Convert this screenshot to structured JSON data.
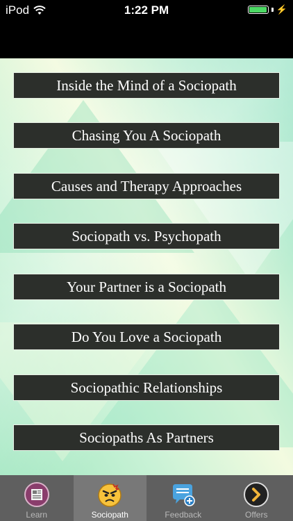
{
  "status_bar": {
    "carrier": "iPod",
    "time": "1:22 PM",
    "battery_level": 1.0,
    "charging": true
  },
  "menu": {
    "items": [
      "Inside the Mind of a Sociopath",
      "Chasing You A Sociopath",
      "Causes and Therapy Approaches",
      "Sociopath vs. Psychopath",
      "Your Partner is a Sociopath",
      "Do You Love a Sociopath",
      "Sociopathic Relationships",
      "Sociopaths As Partners"
    ]
  },
  "tab_bar": {
    "tabs": [
      {
        "label": "Learn",
        "icon": "learn-icon"
      },
      {
        "label": "Sociopath",
        "icon": "angry-face-icon"
      },
      {
        "label": "Feedback",
        "icon": "feedback-icon"
      },
      {
        "label": "Offers",
        "icon": "offers-icon"
      }
    ],
    "selected": "Sociopath"
  },
  "colors": {
    "button_bg": "#2c2f2b",
    "tab_bar_bg": "#5f5f5f",
    "battery_green": "#4cd964"
  }
}
